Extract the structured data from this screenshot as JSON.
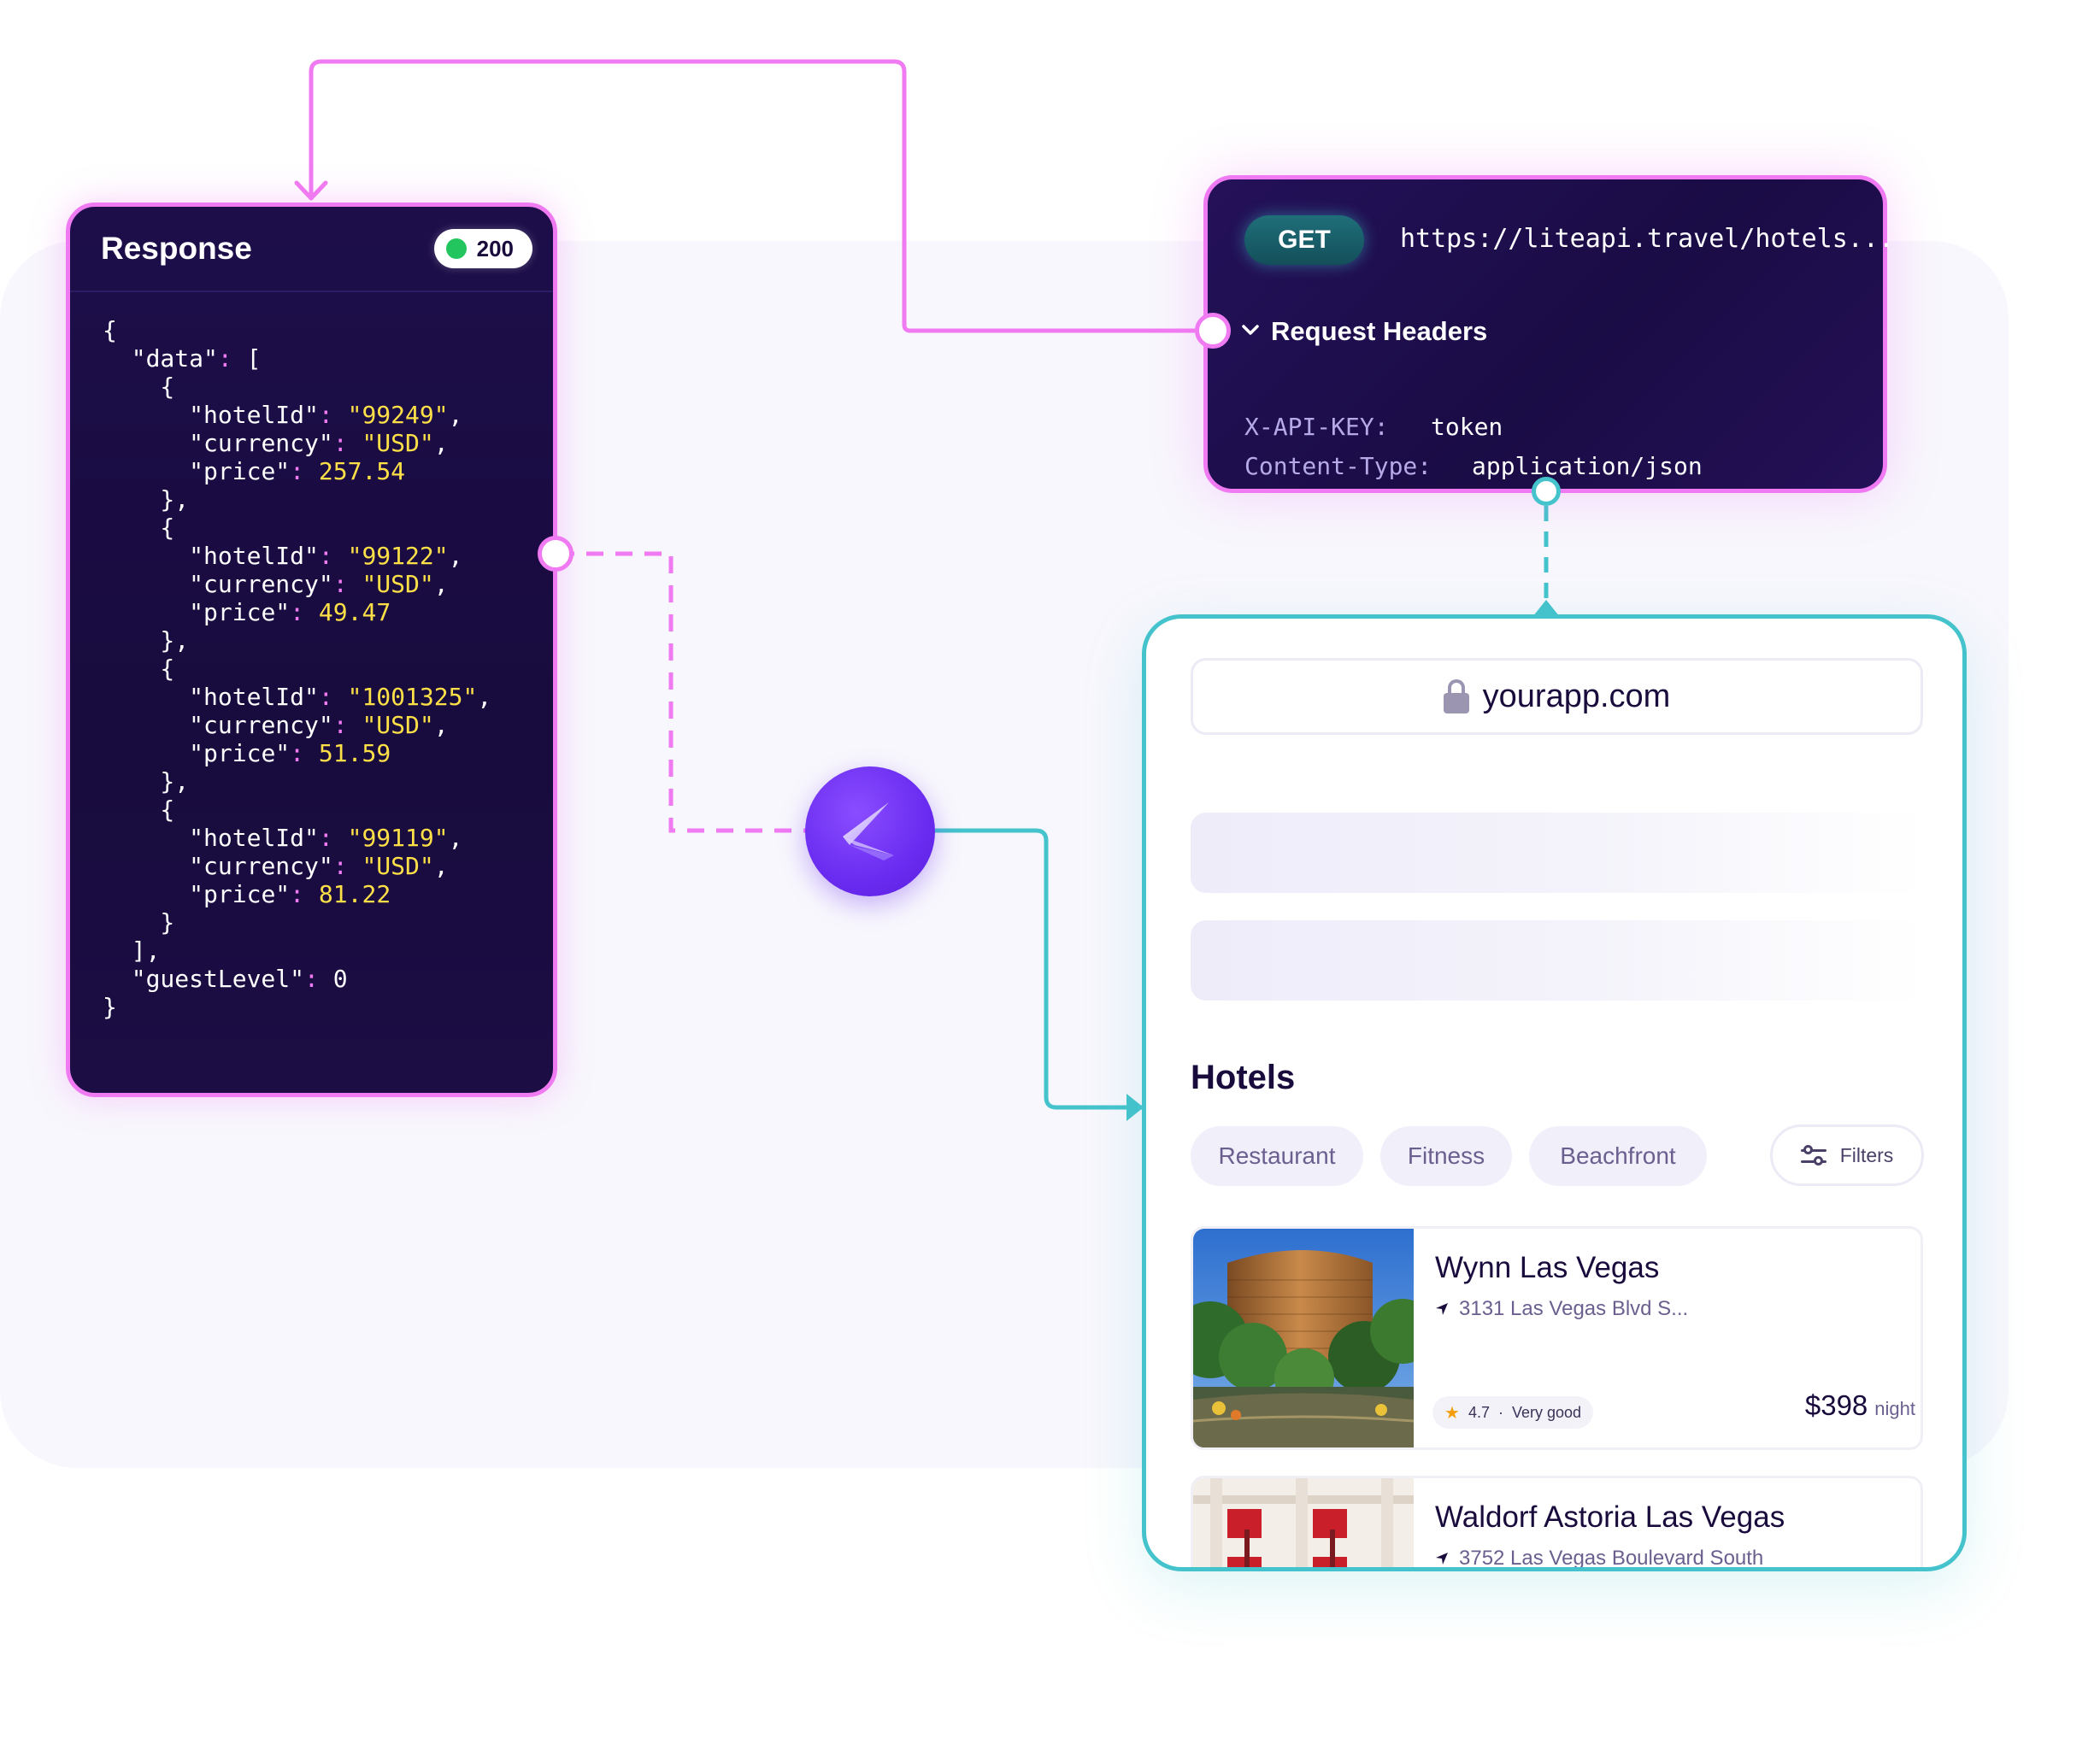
{
  "response_panel": {
    "title": "Response",
    "status_code": "200",
    "status_color": "#22c55e",
    "json_lines": [
      "{",
      "  \"data\": [",
      "    {",
      "      \"hotelId\": \"99249\",",
      "      \"currency\": \"USD\",",
      "      \"price\": 257.54",
      "    },",
      "    {",
      "      \"hotelId\": \"99122\",",
      "      \"currency\": \"USD\",",
      "      \"price\": 49.47",
      "    },",
      "    {",
      "      \"hotelId\": \"1001325\",",
      "      \"currency\": \"USD\",",
      "      \"price\": 51.59",
      "    },",
      "    {",
      "      \"hotelId\": \"99119\",",
      "      \"currency\": \"USD\",",
      "      \"price\": 81.22",
      "    }",
      "  ],",
      "  \"guestLevel\": 0",
      "}"
    ]
  },
  "request_panel": {
    "method": "GET",
    "url": "https://liteapi.travel/hotels...",
    "headers_label": "Request Headers",
    "headers": [
      {
        "key": "X-API-KEY:",
        "value": "token"
      },
      {
        "key": "Content-Type:",
        "value": "application/json"
      }
    ]
  },
  "browser": {
    "url": "yourapp.com",
    "section_title": "Hotels",
    "chips": [
      "Restaurant",
      "Fitness",
      "Beachfront"
    ],
    "filters_label": "Filters",
    "hotels": [
      {
        "name": "Wynn Las Vegas",
        "address": "3131 Las Vegas Blvd S...",
        "rating": "4.7",
        "rating_text": "Very good",
        "price": "$398",
        "per": "night"
      },
      {
        "name": "Waldorf Astoria Las Vegas",
        "address": "3752 Las Vegas Boulevard South"
      }
    ]
  },
  "colors": {
    "pink_accent": "#f07af2",
    "teal_accent": "#45c3cc",
    "panel_dark": "#1a0c45",
    "brand_purple": "#6a2cf0",
    "json_value": "#fde047"
  },
  "icons": [
    "lock-icon",
    "chevron-down-icon",
    "filter-icon",
    "navigation-arrow-icon",
    "star-icon",
    "brand-logo-icon",
    "arrow-down-icon"
  ]
}
